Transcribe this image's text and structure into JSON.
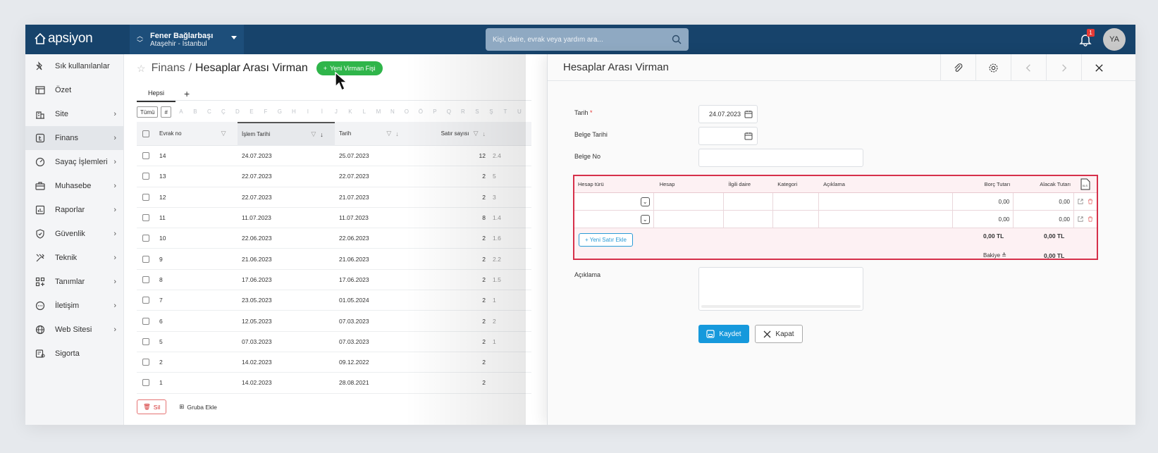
{
  "app": {
    "logo": "apsiyon"
  },
  "site": {
    "name": "Fener Bağlarbaşı",
    "location": "Ataşehir - İstanbul"
  },
  "search": {
    "placeholder": "Kişi, daire, evrak veya yardım ara..."
  },
  "notifications": {
    "count": "1"
  },
  "user": {
    "initials": "YA"
  },
  "sidebar": {
    "items": [
      {
        "label": "Sık kullanılanlar",
        "icon": "pin-icon",
        "chevron": false,
        "active": false
      },
      {
        "label": "Özet",
        "icon": "table-icon",
        "chevron": false,
        "active": false
      },
      {
        "label": "Site",
        "icon": "building-icon",
        "chevron": true,
        "active": false
      },
      {
        "label": "Finans",
        "icon": "finance-icon",
        "chevron": true,
        "active": true
      },
      {
        "label": "Sayaç İşlemleri",
        "icon": "gauge-icon",
        "chevron": true,
        "active": false
      },
      {
        "label": "Muhasebe",
        "icon": "briefcase-icon",
        "chevron": true,
        "active": false
      },
      {
        "label": "Raporlar",
        "icon": "report-icon",
        "chevron": true,
        "active": false
      },
      {
        "label": "Güvenlik",
        "icon": "shield-icon",
        "chevron": true,
        "active": false
      },
      {
        "label": "Teknik",
        "icon": "tools-icon",
        "chevron": true,
        "active": false
      },
      {
        "label": "Tanımlar",
        "icon": "grid-plus-icon",
        "chevron": true,
        "active": false
      },
      {
        "label": "İletişim",
        "icon": "chat-icon",
        "chevron": true,
        "active": false
      },
      {
        "label": "Web Sitesi",
        "icon": "globe-icon",
        "chevron": true,
        "active": false
      },
      {
        "label": "Sigorta",
        "icon": "insurance-icon",
        "chevron": false,
        "active": false
      }
    ]
  },
  "page": {
    "breadcrumb_root": "Finans",
    "breadcrumb_sep": "/",
    "title": "Hesaplar Arası Virman",
    "new_button": "Yeni Virman Fişi"
  },
  "tabs": {
    "all": "Hepsi",
    "add": "+"
  },
  "alpha": [
    "Tümü",
    "#",
    "A",
    "B",
    "C",
    "Ç",
    "D",
    "E",
    "F",
    "G",
    "H",
    "I",
    "İ",
    "J",
    "K",
    "L",
    "M",
    "N",
    "O",
    "Ö",
    "P",
    "Q",
    "R",
    "S",
    "Ş",
    "T",
    "U"
  ],
  "table": {
    "headers": {
      "evrak_no": "Evrak no",
      "islem_tarihi": "İşlem Tarihi",
      "tarih": "Tarih",
      "satir_sayisi": "Satır sayısı"
    },
    "rows": [
      {
        "no": "14",
        "islem": "24.07.2023",
        "tarih": "25.07.2023",
        "satir": "12",
        "extra": "2.4"
      },
      {
        "no": "13",
        "islem": "22.07.2023",
        "tarih": "22.07.2023",
        "satir": "2",
        "extra": "5"
      },
      {
        "no": "12",
        "islem": "22.07.2023",
        "tarih": "21.07.2023",
        "satir": "2",
        "extra": "3"
      },
      {
        "no": "11",
        "islem": "11.07.2023",
        "tarih": "11.07.2023",
        "satir": "8",
        "extra": "1.4"
      },
      {
        "no": "10",
        "islem": "22.06.2023",
        "tarih": "22.06.2023",
        "satir": "2",
        "extra": "1.6"
      },
      {
        "no": "9",
        "islem": "21.06.2023",
        "tarih": "21.06.2023",
        "satir": "2",
        "extra": "2.2"
      },
      {
        "no": "8",
        "islem": "17.06.2023",
        "tarih": "17.06.2023",
        "satir": "2",
        "extra": "1.5"
      },
      {
        "no": "7",
        "islem": "23.05.2023",
        "tarih": "01.05.2024",
        "satir": "2",
        "extra": "1"
      },
      {
        "no": "6",
        "islem": "12.05.2023",
        "tarih": "07.03.2023",
        "satir": "2",
        "extra": "2"
      },
      {
        "no": "5",
        "islem": "07.03.2023",
        "tarih": "07.03.2023",
        "satir": "2",
        "extra": "1"
      },
      {
        "no": "2",
        "islem": "14.02.2023",
        "tarih": "09.12.2022",
        "satir": "2",
        "extra": ""
      },
      {
        "no": "1",
        "islem": "14.02.2023",
        "tarih": "28.08.2021",
        "satir": "2",
        "extra": ""
      }
    ]
  },
  "actions": {
    "delete": "Sil",
    "add_group": "Gruba Ekle"
  },
  "panel": {
    "title": "Hesaplar Arası Virman",
    "form": {
      "tarih_label": "Tarih",
      "tarih_required": "*",
      "tarih_value": "24.07.2023",
      "belge_tarihi_label": "Belge Tarihi",
      "belge_tarihi_value": "",
      "belge_no_label": "Belge No",
      "belge_no_value": "",
      "aciklama_label": "Açıklama"
    },
    "grid": {
      "headers": {
        "hesap_turu": "Hesap türü",
        "hesap": "Hesap",
        "ilgili_daire": "İlgili daire",
        "kategori": "Kategori",
        "aciklama": "Açıklama",
        "borc": "Borç Tutarı",
        "alacak": "Alacak Tutarı"
      },
      "rows": [
        {
          "borc": "0,00",
          "alacak": "0,00"
        },
        {
          "borc": "0,00",
          "alacak": "0,00"
        }
      ],
      "add_row": "Yeni Satır Ekle",
      "total_borc": "0,00 TL",
      "total_alacak": "0,00 TL",
      "bakiye_label": "Bakiye",
      "bakiye_value": "0,00 TL"
    },
    "save": "Kaydet",
    "close": "Kapat"
  },
  "colors": {
    "topbar": "#17436b",
    "accent_green": "#2fb54a",
    "primary_blue": "#1699dc",
    "error_red": "#d6304a"
  }
}
